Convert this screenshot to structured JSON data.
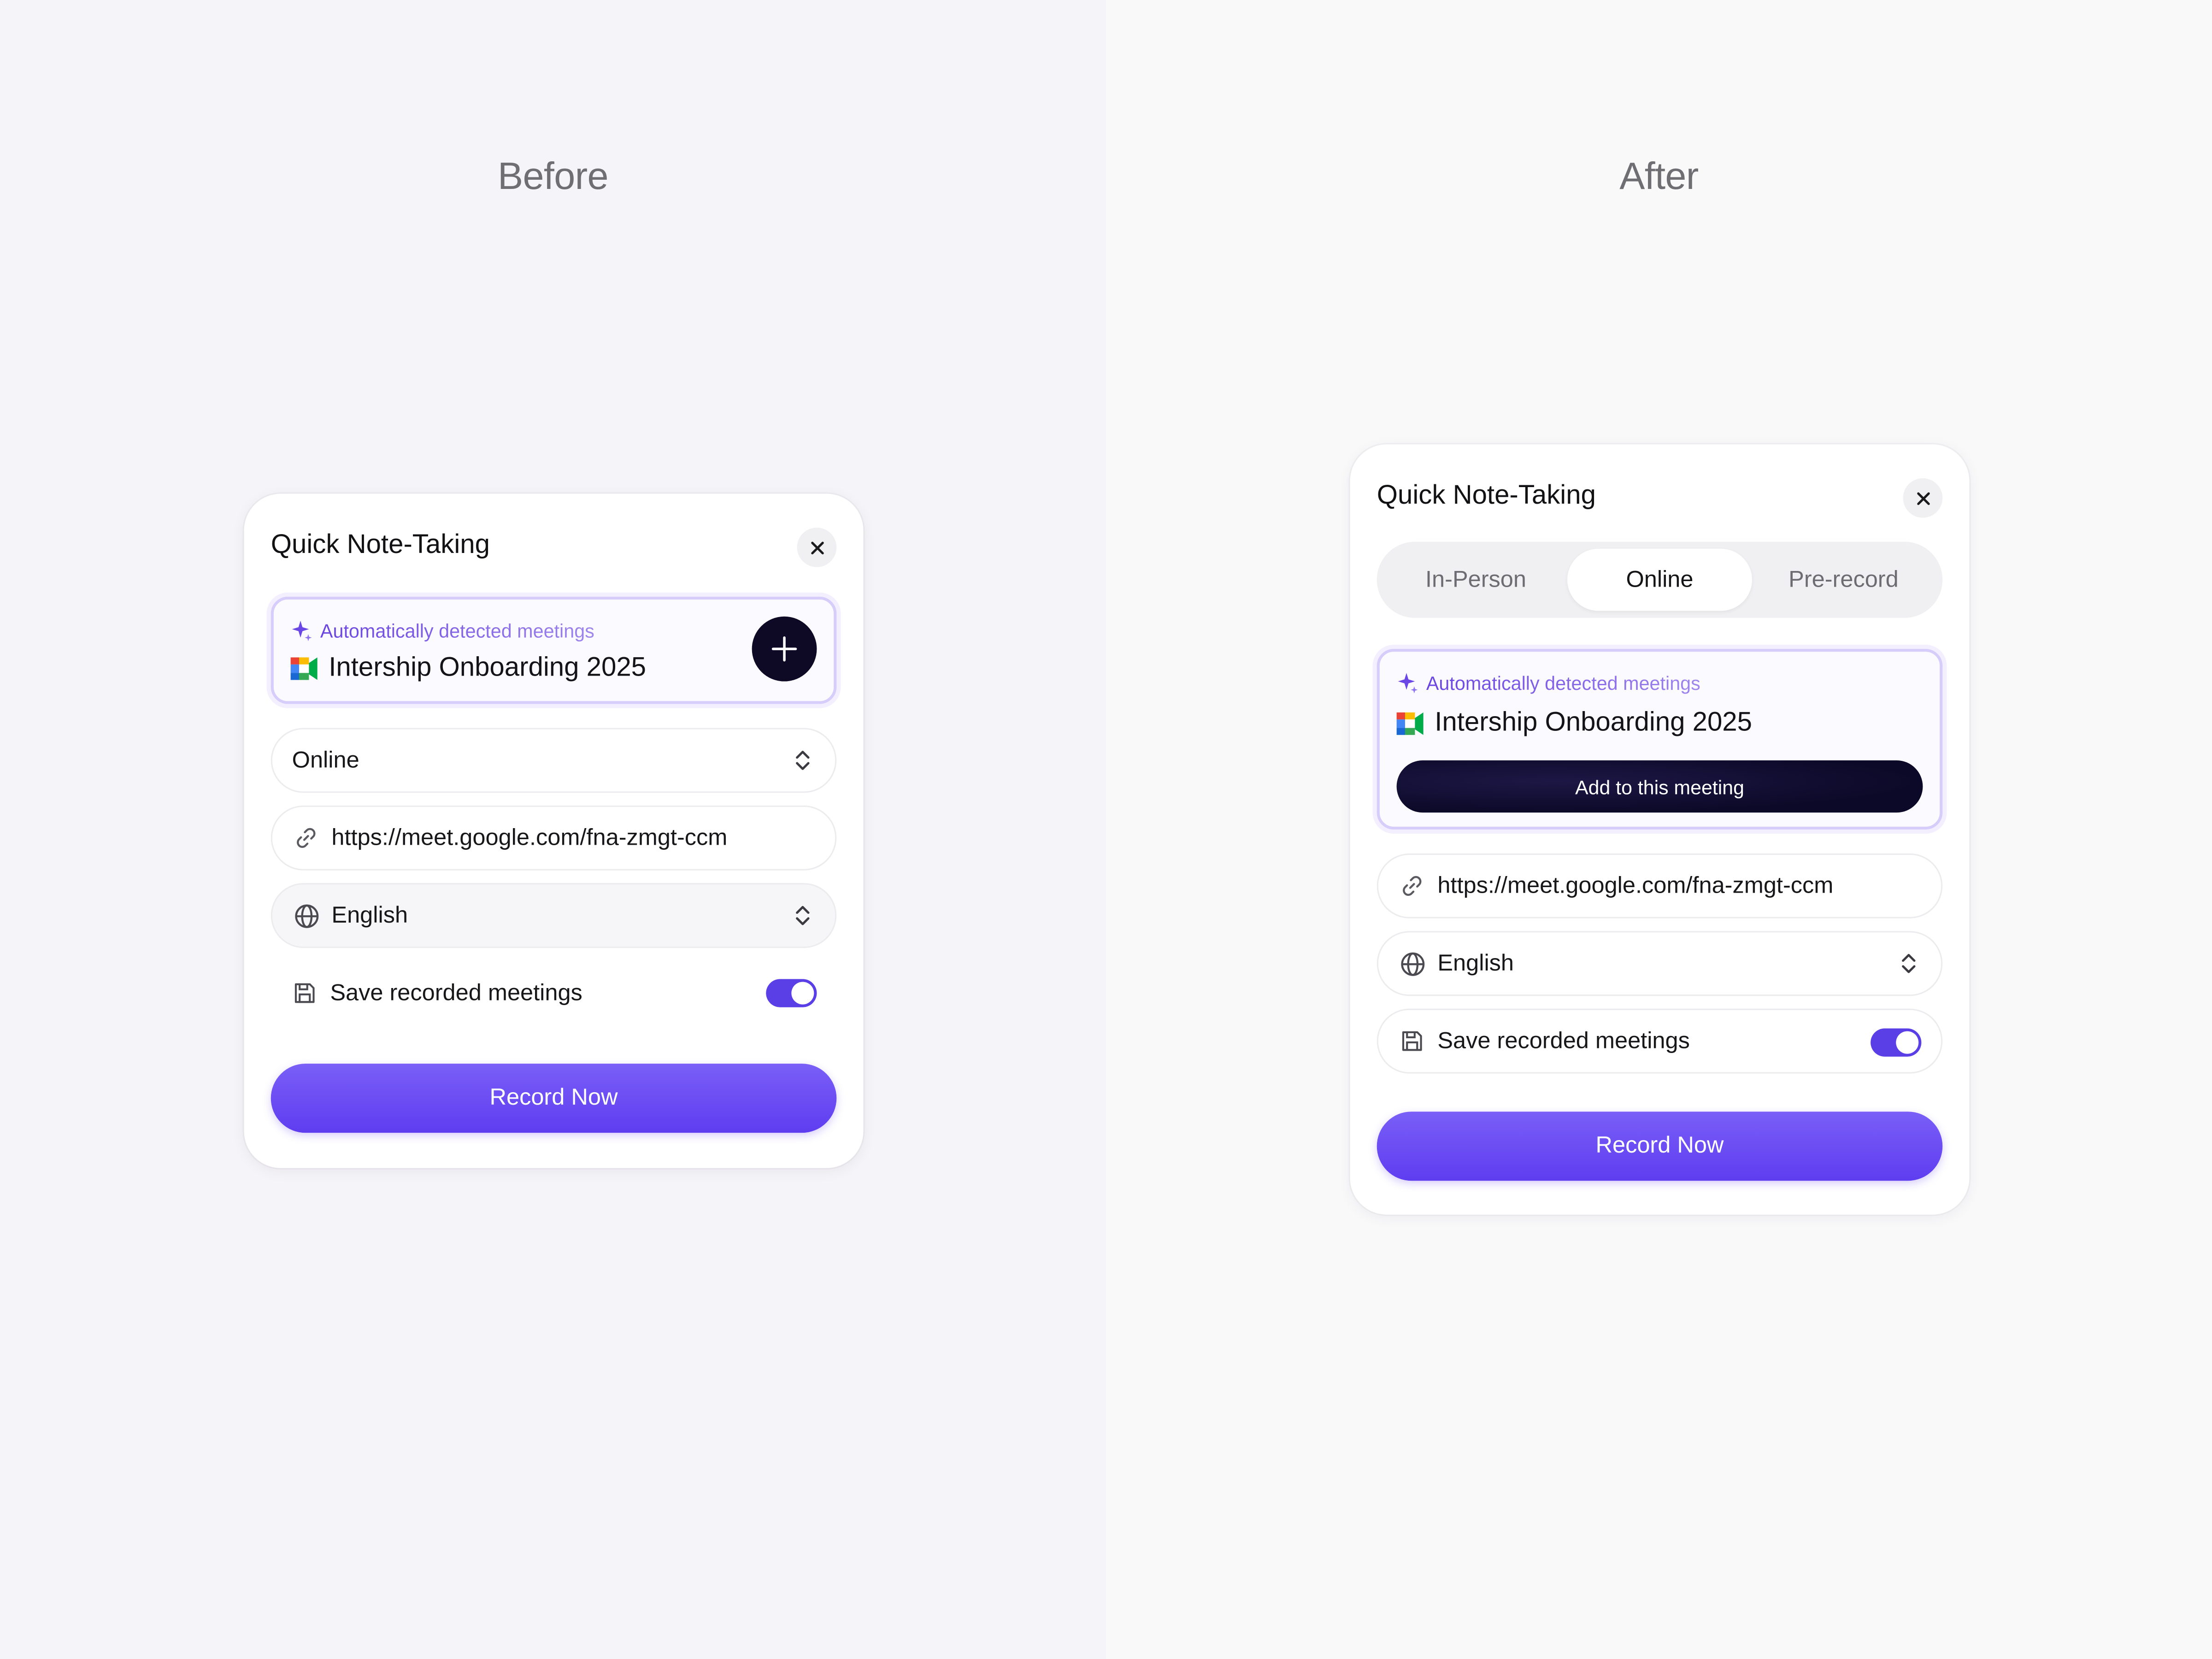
{
  "before": {
    "caption": "Before",
    "card": {
      "title": "Quick Note-Taking",
      "detected": {
        "label": "Automatically detected meetings",
        "meeting_name": "Intership Onboarding 2025"
      },
      "mode_select": {
        "value": "Online"
      },
      "link_field": {
        "value": "https://meet.google.com/fna-zmgt-ccm"
      },
      "language_select": {
        "value": "English"
      },
      "save_toggle": {
        "label": "Save recorded meetings",
        "on": true
      },
      "record_button": "Record Now"
    }
  },
  "after": {
    "caption": "After",
    "card": {
      "title": "Quick Note-Taking",
      "tabs": [
        {
          "label": "In-Person",
          "active": false
        },
        {
          "label": "Online",
          "active": true
        },
        {
          "label": "Pre-record",
          "active": false
        }
      ],
      "detected": {
        "label": "Automatically detected meetings",
        "meeting_name": "Intership Onboarding 2025",
        "add_button": "Add to this meeting"
      },
      "link_field": {
        "value": "https://meet.google.com/fna-zmgt-ccm"
      },
      "language_select": {
        "value": "English"
      },
      "save_toggle": {
        "label": "Save recorded meetings",
        "on": true
      },
      "record_button": "Record Now"
    }
  },
  "icons": [
    "sparkle-icon",
    "google-meet-icon",
    "plus-icon",
    "close-icon",
    "link-icon",
    "globe-icon",
    "chevron-updown-icon",
    "save-icon"
  ],
  "colors": {
    "accent": "#5e3df0",
    "dark_button": "#0e0a26",
    "detected_border": "#d7cdfb"
  }
}
